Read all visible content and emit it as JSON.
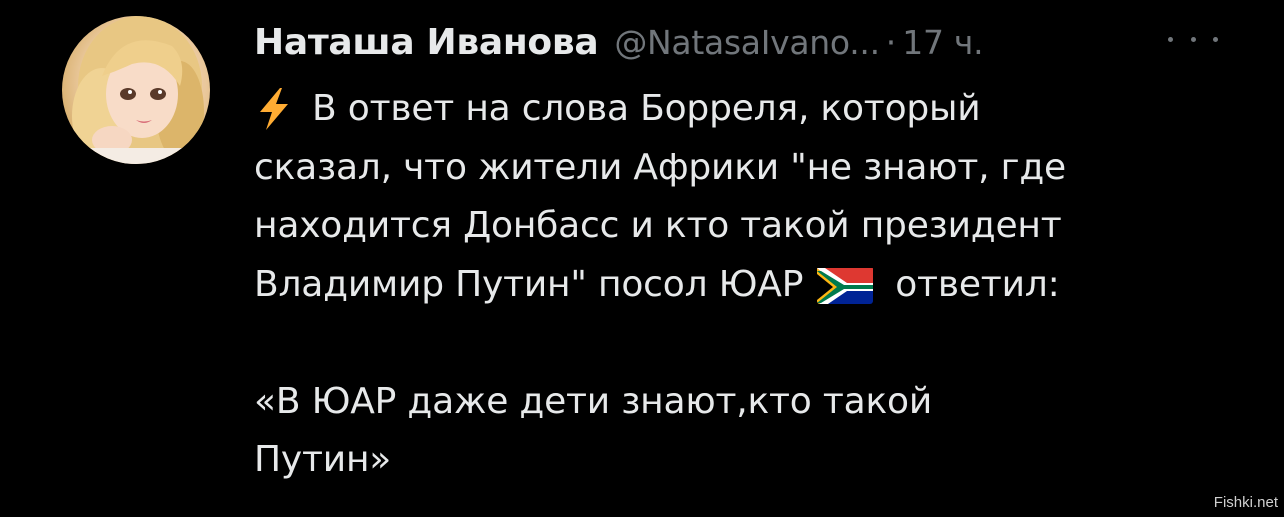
{
  "tweet": {
    "author": {
      "display_name": "Наташа Иванова",
      "handle": "@NatasaIvano...",
      "separator": "·",
      "timestamp": "17 ч."
    },
    "more_icon": "ellipsis-icon",
    "lines": [
      {
        "icon": "lightning-icon",
        "text": "В ответ на слова Борреля, который"
      },
      {
        "text": "сказал, что жители Африки \"не знают, где"
      },
      {
        "text": "находится Донбасс и кто такой президент"
      },
      {
        "text_before": "Владимир Путин\" посол ЮАР",
        "icon": "south-africa-flag-icon",
        "text_after": "ответил:"
      },
      {
        "text": ""
      },
      {
        "text": "«В ЮАР даже дети знают,кто такой"
      },
      {
        "text": "Путин»"
      }
    ]
  },
  "watermark": "Fishki.net",
  "colors": {
    "background": "#000000",
    "primary_text": "#e7e9ea",
    "secondary_text": "#71767b",
    "lightning": "#ffac33"
  }
}
